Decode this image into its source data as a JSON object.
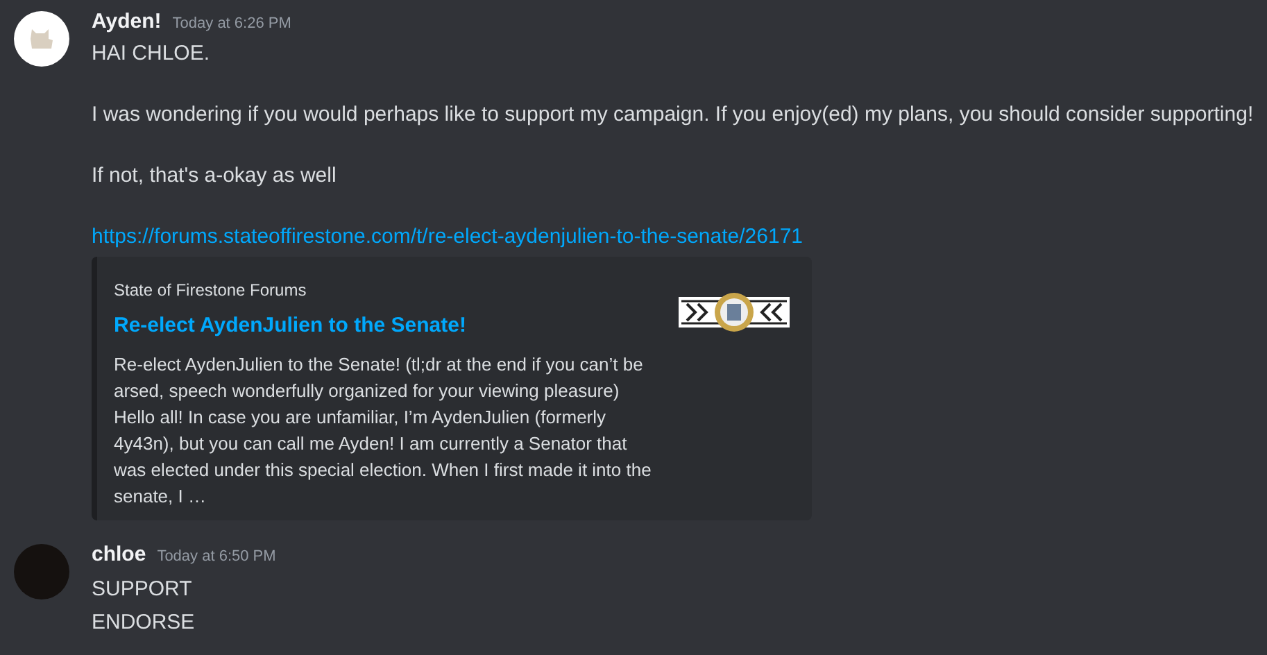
{
  "messages": [
    {
      "author": "Ayden!",
      "timestamp": "Today at 6:26 PM",
      "paragraphs": [
        "HAI CHLOE.",
        "I was wondering if you would perhaps like to support my campaign. If you enjoy(ed) my plans, you should consider supporting!",
        "If not, that's a-okay as well"
      ],
      "link": "https://forums.stateoffirestone.com/t/re-elect-aydenjulien-to-the-senate/26171",
      "embed": {
        "provider": "State of Firestone Forums",
        "title": "Re-elect AydenJulien to the Senate!",
        "description": "Re-elect AydenJulien to the Senate! (tl;dr at the end if you can’t be arsed, speech wonderfully organized for your viewing pleasure) Hello all! In case you are unfamiliar, I’m AydenJulien (formerly 4y43n), but you can call me Ayden! I am currently a Senator that was elected under this special election. When I first made it into the senate, I …"
      }
    },
    {
      "author": "chloe",
      "timestamp": "Today at 6:50 PM",
      "lines": [
        "SUPPORT",
        "ENDORSE"
      ]
    }
  ]
}
